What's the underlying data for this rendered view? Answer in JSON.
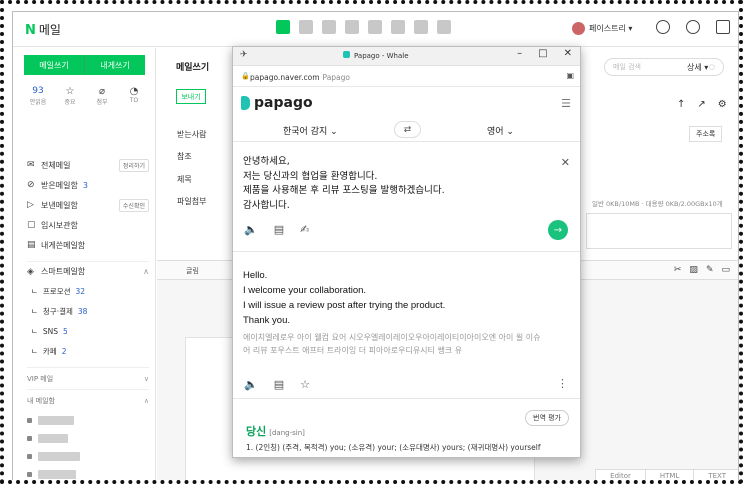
{
  "topbar": {
    "logo_n": "N",
    "logo_text": "메일",
    "app_icons": [
      "mail-app-icon",
      "calendar-icon",
      "list-icon",
      "download-icon",
      "package-icon",
      "briefcase-icon",
      "home-icon",
      "grid-icon"
    ],
    "user_name": "페이스트리 ▾"
  },
  "sidebar": {
    "write_mail": "메일쓰기",
    "write_self": "내게쓰기",
    "stats": [
      {
        "value": "93",
        "label": "안읽음"
      },
      {
        "value": "☆",
        "label": "중요"
      },
      {
        "value": "⌀",
        "label": "첨부"
      },
      {
        "value": "◔",
        "label": "TO"
      }
    ],
    "folders": [
      {
        "icon": "✉",
        "label": "전체메일",
        "count": "",
        "tag": "정리하기"
      },
      {
        "icon": "⊘",
        "label": "받은메일함",
        "count": "3",
        "tag": ""
      },
      {
        "icon": "▷",
        "label": "보낸메일함",
        "count": "",
        "tag": "수신확인"
      },
      {
        "icon": "▢",
        "label": "임시보관함",
        "count": "",
        "tag": ""
      },
      {
        "icon": "▤",
        "label": "내게쓴메일함",
        "count": "",
        "tag": ""
      }
    ],
    "smart_section": {
      "label": "스마트메일함",
      "chevron": "∧"
    },
    "smart_items": [
      {
        "label": "프로모션",
        "count": "32"
      },
      {
        "label": "청구·결제",
        "count": "38"
      },
      {
        "label": "SNS",
        "count": "5"
      },
      {
        "label": "카페",
        "count": "2"
      }
    ],
    "vip_section": {
      "label": "VIP 메일",
      "chevron": "∨"
    },
    "my_section": {
      "label": "내 메일함",
      "chevron": "∧"
    }
  },
  "compose": {
    "title": "메일쓰기",
    "send_button": "보내기",
    "labels": {
      "to": "받는사람",
      "cc": "참조",
      "subject": "제목",
      "attach": "파일첨부"
    },
    "search_placeholder": "메일 검색",
    "detail_label": "상세 ▾",
    "address_button": "주소록",
    "quota": "일반 0KB/10MB · 대용량 0KB/2.00GBx10개",
    "toolbar_label": "글림",
    "editor_tabs": [
      "Editor",
      "HTML",
      "TEXT"
    ]
  },
  "popup": {
    "window_title": "Papago - Whale",
    "url_host": "papago.naver.com",
    "url_site": "Papago",
    "logo": "papago",
    "source_lang": "한국어 감지 ⌄",
    "target_lang": "영어 ⌄",
    "swap_label": "⇄",
    "source_lines": [
      "안녕하세요,",
      "저는 당신과의 협업을 환영합니다.",
      "제품을 사용해본 후 리뷰 포스팅을 발행하겠습니다.",
      "감사합니다."
    ],
    "target_lines": [
      "Hello.",
      "I welcome your collaboration.",
      "I will issue a review post after trying the product.",
      "Thank you."
    ],
    "pronunciation": "에이치엘레로우 아이 웰컴 요어 시오우엘레이레이오우아이레이티이아이오엔 아이 윌 이슈 어 리뷰 포우스트 애프터 트라이잉 더 피아아로우디유시티 쌩크 유",
    "eval_button": "번역 평가",
    "dict_word": "당신",
    "dict_tag": "[dang-sin]",
    "dict_def": "1. (2인칭) (주격, 목적격) you; (소유격) your; (소유대명사) yours; (재귀대명사) yourself"
  }
}
